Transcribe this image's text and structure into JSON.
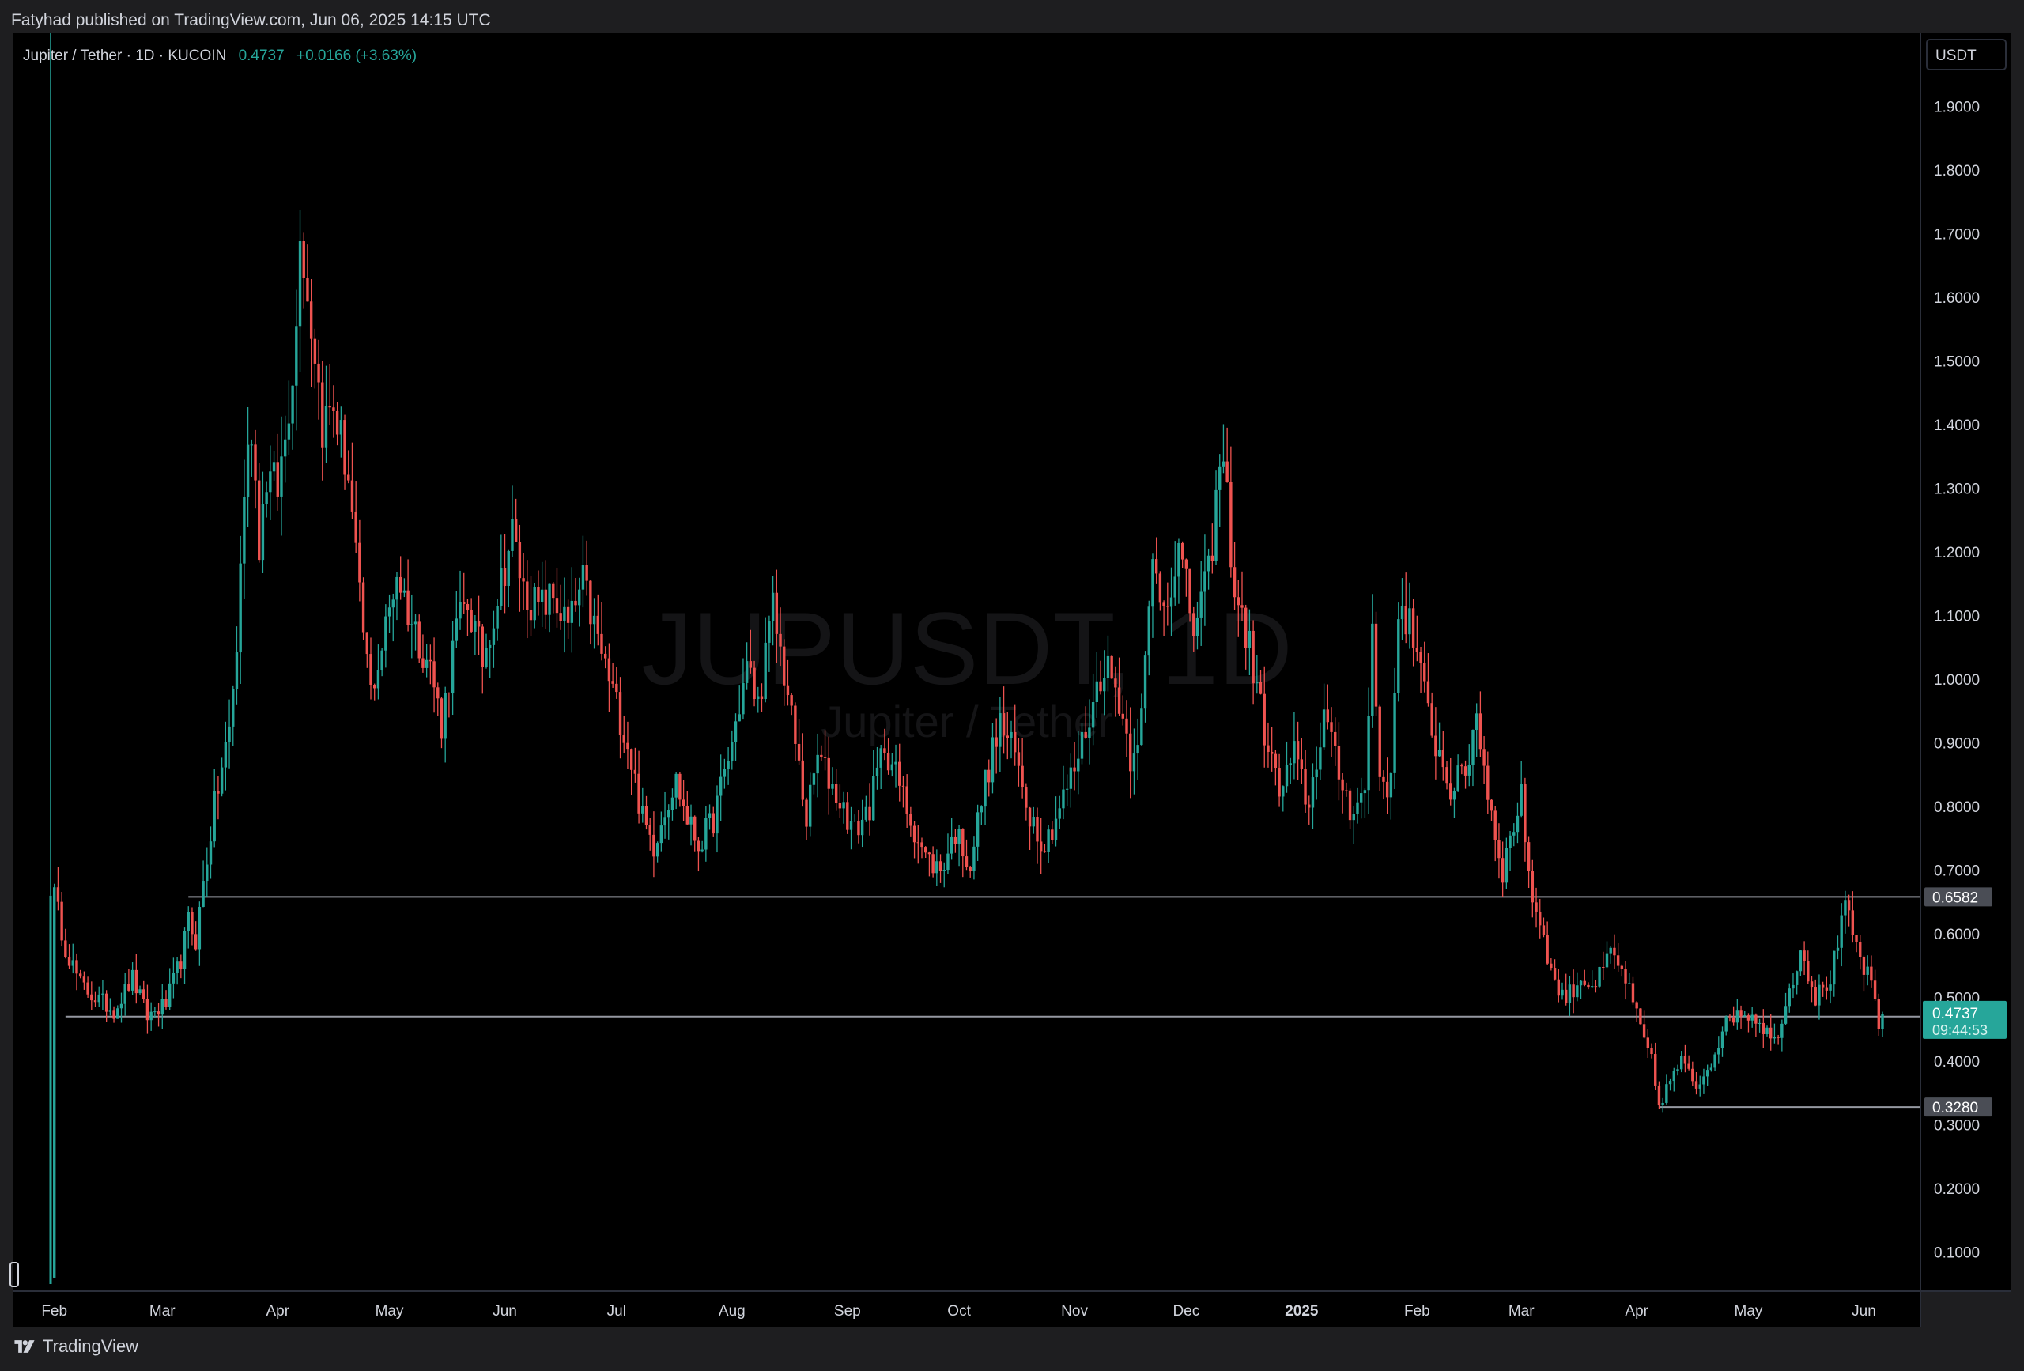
{
  "header": {
    "publish_line": "Fatyhad published on TradingView.com, Jun 06, 2025 14:15 UTC"
  },
  "legend": {
    "symbol_line": "Jupiter / Tether · 1D · KUCOIN",
    "last": "0.4737",
    "change": "+0.0166 (+3.63%)"
  },
  "watermark": {
    "symbol": "JUPUSDT, 1D",
    "name": "Jupiter / Tether"
  },
  "currency_button": "USDT",
  "footer": {
    "brand": "TradingView"
  },
  "colors": {
    "up": "#26a69a",
    "down": "#ef5350",
    "background": "#000000",
    "frame": "#1e1e20",
    "text": "#d1d4dc",
    "hline": "#9598a1"
  },
  "chart_data": {
    "type": "candlestick",
    "title": "Jupiter / Tether · 1D · KUCOIN",
    "ylabel": "USDT",
    "ylim": [
      0.05,
      2.0
    ],
    "grid": false,
    "y_ticks": [
      "0.1000",
      "0.2000",
      "0.3000",
      "0.4000",
      "0.5000",
      "0.6000",
      "0.7000",
      "0.8000",
      "0.9000",
      "1.0000",
      "1.1000",
      "1.2000",
      "1.3000",
      "1.4000",
      "1.5000",
      "1.6000",
      "1.7000",
      "1.8000",
      "1.9000"
    ],
    "x_ticks": [
      "Feb",
      "Mar",
      "Apr",
      "May",
      "Jun",
      "Jul",
      "Aug",
      "Sep",
      "Oct",
      "Nov",
      "Dec",
      "2025",
      "Feb",
      "Mar",
      "Apr",
      "May",
      "Jun"
    ],
    "x_range": [
      "2024-01-31",
      "2025-06-06"
    ],
    "horizontal_lines": [
      {
        "value": 0.6582,
        "label": "0.6582",
        "from": "2024-03-08"
      },
      {
        "value": 0.4701,
        "label": "0.4701",
        "from": "2024-02-04"
      },
      {
        "value": 0.328,
        "label": "0.3280",
        "from": "2025-04-07"
      }
    ],
    "last_price": {
      "value": 0.4737,
      "label": "0.4737",
      "countdown": "09:44:53"
    },
    "anchors": [
      [
        "2024-01-31",
        0.05
      ],
      [
        "2024-02-01",
        0.66
      ],
      [
        "2024-02-04",
        0.58
      ],
      [
        "2024-02-08",
        0.52
      ],
      [
        "2024-02-12",
        0.5
      ],
      [
        "2024-02-17",
        0.48
      ],
      [
        "2024-02-22",
        0.53
      ],
      [
        "2024-02-26",
        0.47
      ],
      [
        "2024-03-02",
        0.49
      ],
      [
        "2024-03-06",
        0.56
      ],
      [
        "2024-03-08",
        0.62
      ],
      [
        "2024-03-10",
        0.59
      ],
      [
        "2024-03-12",
        0.68
      ],
      [
        "2024-03-15",
        0.8
      ],
      [
        "2024-03-19",
        0.92
      ],
      [
        "2024-03-21",
        1.05
      ],
      [
        "2024-03-23",
        1.3
      ],
      [
        "2024-03-25",
        1.4
      ],
      [
        "2024-03-27",
        1.22
      ],
      [
        "2024-03-29",
        1.32
      ],
      [
        "2024-04-01",
        1.3
      ],
      [
        "2024-04-03",
        1.38
      ],
      [
        "2024-04-06",
        1.55
      ],
      [
        "2024-04-07",
        1.73
      ],
      [
        "2024-04-09",
        1.6
      ],
      [
        "2024-04-11",
        1.52
      ],
      [
        "2024-04-13",
        1.4
      ],
      [
        "2024-04-16",
        1.43
      ],
      [
        "2024-04-20",
        1.32
      ],
      [
        "2024-04-23",
        1.12
      ],
      [
        "2024-04-26",
        0.98
      ],
      [
        "2024-04-29",
        1.05
      ],
      [
        "2024-05-03",
        1.17
      ],
      [
        "2024-05-07",
        1.09
      ],
      [
        "2024-05-12",
        1.02
      ],
      [
        "2024-05-15",
        0.93
      ],
      [
        "2024-05-19",
        1.08
      ],
      [
        "2024-05-22",
        1.12
      ],
      [
        "2024-05-26",
        1.03
      ],
      [
        "2024-06-01",
        1.18
      ],
      [
        "2024-06-03",
        1.23
      ],
      [
        "2024-06-06",
        1.14
      ],
      [
        "2024-06-10",
        1.11
      ],
      [
        "2024-06-14",
        1.13
      ],
      [
        "2024-06-18",
        1.08
      ],
      [
        "2024-06-22",
        1.15
      ],
      [
        "2024-06-26",
        1.06
      ],
      [
        "2024-06-30",
        0.98
      ],
      [
        "2024-07-04",
        0.9
      ],
      [
        "2024-07-08",
        0.78
      ],
      [
        "2024-07-11",
        0.74
      ],
      [
        "2024-07-14",
        0.8
      ],
      [
        "2024-07-17",
        0.84
      ],
      [
        "2024-07-20",
        0.78
      ],
      [
        "2024-07-23",
        0.74
      ],
      [
        "2024-07-27",
        0.78
      ],
      [
        "2024-08-01",
        0.9
      ],
      [
        "2024-08-05",
        1.02
      ],
      [
        "2024-08-08",
        0.96
      ],
      [
        "2024-08-12",
        1.11
      ],
      [
        "2024-08-15",
        1.01
      ],
      [
        "2024-08-18",
        0.9
      ],
      [
        "2024-08-21",
        0.78
      ],
      [
        "2024-08-24",
        0.88
      ],
      [
        "2024-08-29",
        0.82
      ],
      [
        "2024-09-03",
        0.76
      ],
      [
        "2024-09-07",
        0.8
      ],
      [
        "2024-09-11",
        0.9
      ],
      [
        "2024-09-14",
        0.85
      ],
      [
        "2024-09-18",
        0.78
      ],
      [
        "2024-09-22",
        0.72
      ],
      [
        "2024-09-26",
        0.7
      ],
      [
        "2024-09-30",
        0.76
      ],
      [
        "2024-10-04",
        0.71
      ],
      [
        "2024-10-08",
        0.84
      ],
      [
        "2024-10-12",
        0.93
      ],
      [
        "2024-10-16",
        0.88
      ],
      [
        "2024-10-20",
        0.79
      ],
      [
        "2024-10-24",
        0.74
      ],
      [
        "2024-10-28",
        0.8
      ],
      [
        "2024-11-01",
        0.86
      ],
      [
        "2024-11-05",
        0.94
      ],
      [
        "2024-11-09",
        1.03
      ],
      [
        "2024-11-13",
        0.97
      ],
      [
        "2024-11-16",
        0.88
      ],
      [
        "2024-11-19",
        0.94
      ],
      [
        "2024-11-22",
        1.18
      ],
      [
        "2024-11-25",
        1.12
      ],
      [
        "2024-11-29",
        1.2
      ],
      [
        "2024-12-03",
        1.08
      ],
      [
        "2024-12-07",
        1.16
      ],
      [
        "2024-12-09",
        1.28
      ],
      [
        "2024-12-11",
        1.35
      ],
      [
        "2024-12-14",
        1.14
      ],
      [
        "2024-12-18",
        1.05
      ],
      [
        "2024-12-22",
        0.92
      ],
      [
        "2024-12-26",
        0.82
      ],
      [
        "2024-12-30",
        0.88
      ],
      [
        "2025-01-03",
        0.8
      ],
      [
        "2025-01-07",
        0.95
      ],
      [
        "2025-01-10",
        0.87
      ],
      [
        "2025-01-14",
        0.8
      ],
      [
        "2025-01-18",
        0.82
      ],
      [
        "2025-01-20",
        1.08
      ],
      [
        "2025-01-22",
        0.85
      ],
      [
        "2025-01-25",
        0.83
      ],
      [
        "2025-01-27",
        1.12
      ],
      [
        "2025-01-30",
        1.09
      ],
      [
        "2025-02-02",
        1.0
      ],
      [
        "2025-02-06",
        0.9
      ],
      [
        "2025-02-10",
        0.83
      ],
      [
        "2025-02-14",
        0.85
      ],
      [
        "2025-02-17",
        0.95
      ],
      [
        "2025-02-20",
        0.82
      ],
      [
        "2025-02-24",
        0.7
      ],
      [
        "2025-02-27",
        0.77
      ],
      [
        "2025-03-01",
        0.83
      ],
      [
        "2025-03-03",
        0.68
      ],
      [
        "2025-03-06",
        0.62
      ],
      [
        "2025-03-10",
        0.52
      ],
      [
        "2025-03-13",
        0.5
      ],
      [
        "2025-03-17",
        0.53
      ],
      [
        "2025-03-21",
        0.52
      ],
      [
        "2025-03-25",
        0.57
      ],
      [
        "2025-03-29",
        0.53
      ],
      [
        "2025-04-02",
        0.45
      ],
      [
        "2025-04-05",
        0.4
      ],
      [
        "2025-04-07",
        0.33
      ],
      [
        "2025-04-10",
        0.37
      ],
      [
        "2025-04-13",
        0.4
      ],
      [
        "2025-04-17",
        0.36
      ],
      [
        "2025-04-21",
        0.4
      ],
      [
        "2025-04-24",
        0.45
      ],
      [
        "2025-04-28",
        0.48
      ],
      [
        "2025-05-03",
        0.47
      ],
      [
        "2025-05-08",
        0.43
      ],
      [
        "2025-05-12",
        0.51
      ],
      [
        "2025-05-15",
        0.58
      ],
      [
        "2025-05-19",
        0.5
      ],
      [
        "2025-05-23",
        0.53
      ],
      [
        "2025-05-27",
        0.64
      ],
      [
        "2025-05-31",
        0.56
      ],
      [
        "2025-06-03",
        0.52
      ],
      [
        "2025-06-05",
        0.45
      ],
      [
        "2025-06-06",
        0.4737
      ]
    ]
  }
}
